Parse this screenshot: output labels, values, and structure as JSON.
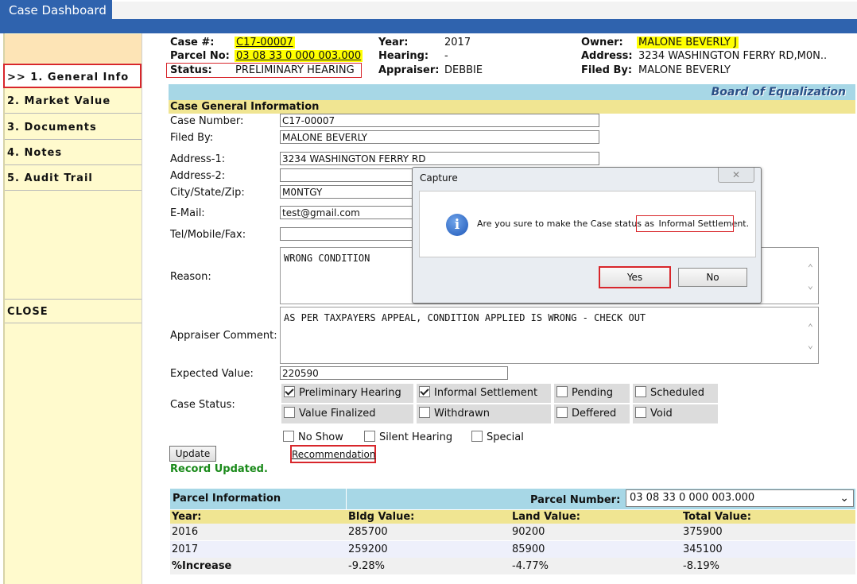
{
  "header": {
    "tab_title": "Case Dashboard"
  },
  "sidebar": {
    "items": [
      {
        "label": ">> 1. General Info"
      },
      {
        "label": "2. Market Value"
      },
      {
        "label": "3. Documents"
      },
      {
        "label": "4. Notes"
      },
      {
        "label": "5. Audit Trail"
      },
      {
        "label": "CLOSE"
      }
    ]
  },
  "case_header": {
    "case_label": "Case #:",
    "case_value": "C17-00007",
    "parcel_label": "Parcel No:",
    "parcel_value": "03 08 33 0 000 003.000",
    "status_label": "Status:",
    "status_value": "PRELIMINARY HEARING",
    "year_label": "Year:",
    "year_value": "2017",
    "hearing_label": "Hearing:",
    "hearing_value": "-",
    "appraiser_label": "Appraiser:",
    "appraiser_value": "DEBBIE",
    "owner_label": "Owner:",
    "owner_value": "MALONE BEVERLY J",
    "address_label": "Address:",
    "address_value": "3234 WASHINGTON FERRY RD,M0N..",
    "filedby_label": "Filed By:",
    "filedby_value": "MALONE BEVERLY"
  },
  "banner": {
    "title": "Board of Equalization",
    "section": "Case General Information"
  },
  "form": {
    "case_number_label": "Case Number:",
    "case_number": "C17-00007",
    "filed_by_label": "Filed By:",
    "filed_by": "MALONE BEVERLY",
    "address1_label": "Address-1:",
    "address1": "3234 WASHINGTON FERRY RD",
    "address2_label": "Address-2:",
    "address2": "",
    "city_label": "City/State/Zip:",
    "city": "M0NTGY",
    "email_label": "E-Mail:",
    "email": "test@gmail.com",
    "tel_label": "Tel/Mobile/Fax:",
    "tel": "",
    "reason_label": "Reason:",
    "reason": "WRONG CONDITION",
    "comment_label": "Appraiser Comment:",
    "comment": "AS PER TAXPAYERS APPEAL, CONDITION APPLIED IS WRONG - CHECK OUT",
    "expected_label": "Expected Value:",
    "expected": "220590",
    "status_label": "Case Status:"
  },
  "statuses": [
    {
      "label": "Preliminary Hearing",
      "checked": true
    },
    {
      "label": "Informal Settlement",
      "checked": true
    },
    {
      "label": "Pending",
      "checked": false
    },
    {
      "label": "Scheduled",
      "checked": false
    },
    {
      "label": "Value Finalized",
      "checked": false
    },
    {
      "label": "Withdrawn",
      "checked": false
    },
    {
      "label": "Deffered",
      "checked": false
    },
    {
      "label": "Void",
      "checked": false
    },
    {
      "label": "No Show",
      "checked": false
    },
    {
      "label": "Silent Hearing",
      "checked": false
    },
    {
      "label": "Special",
      "checked": false
    }
  ],
  "actions": {
    "update": "Update",
    "recommendation": "Recommendation",
    "record_updated": "Record Updated."
  },
  "parcel": {
    "title": "Parcel Information",
    "number_label": "Parcel Number:",
    "number_value": "03 08 33 0 000 003.000",
    "headers": [
      "Year:",
      "Bldg Value:",
      "Land Value:",
      "Total Value:"
    ],
    "rows": [
      [
        "2016",
        "285700",
        "90200",
        "375900"
      ],
      [
        "2017",
        "259200",
        "85900",
        "345100"
      ],
      [
        "%Increase",
        "-9.28%",
        "-4.77%",
        "-8.19%"
      ]
    ]
  },
  "dialog": {
    "title": "Capture",
    "close": "✕",
    "message": "Are you sure to make the Case status as",
    "highlight": "Informal Settlement.",
    "yes": "Yes",
    "no": "No"
  },
  "colors": {
    "header_blue": "#2f63ae",
    "sidebar_yellow": "#fffacd",
    "highlight_red": "#d8262b",
    "banner_blue": "#a7d7e6",
    "section_yellow": "#f0e592"
  }
}
